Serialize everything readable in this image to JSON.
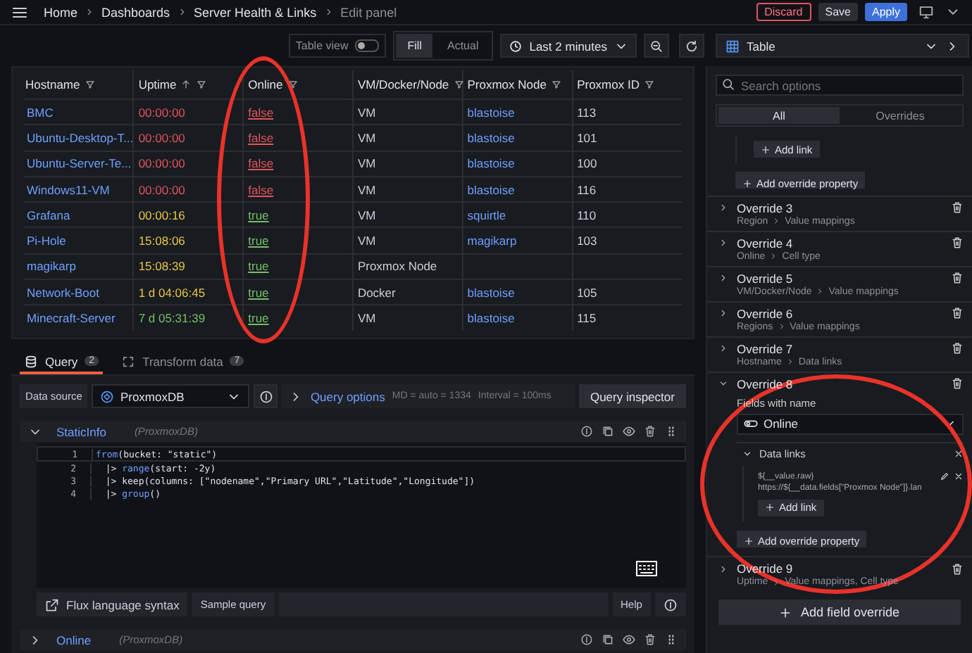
{
  "breadcrumbs": [
    "Home",
    "Dashboards",
    "Server Health & Links",
    "Edit panel"
  ],
  "header_buttons": [
    {
      "label": "Discard",
      "kind": "danger"
    },
    {
      "label": "Save",
      "kind": "secondary"
    },
    {
      "label": "Apply",
      "kind": "primary"
    }
  ],
  "toolbar": {
    "table_view": {
      "label": "Table view",
      "on": false
    },
    "fill_modes": [
      {
        "label": "Fill",
        "selected": true
      },
      {
        "label": "Actual",
        "selected": false
      }
    ],
    "time_range": "Last 2 minutes"
  },
  "visualization": {
    "label": "Table"
  },
  "table": {
    "columns": [
      {
        "label": "Hostname",
        "sorted": false
      },
      {
        "label": "Uptime",
        "sorted": true
      },
      {
        "label": "Online",
        "sorted": false
      },
      {
        "label": "VM/Docker/Node",
        "sorted": false
      },
      {
        "label": "Proxmox Node",
        "sorted": false
      },
      {
        "label": "Proxmox ID",
        "sorted": false
      }
    ],
    "rows": [
      {
        "hostname": "BMC",
        "uptime": {
          "text": "00:00:00",
          "color": "#e0535f"
        },
        "online": {
          "text": "false",
          "color": "#e0535f"
        },
        "type": "VM",
        "proxmox_node": "blastoise",
        "proxmox_id": "113"
      },
      {
        "hostname": "Ubuntu-Desktop-T...",
        "uptime": {
          "text": "00:00:00",
          "color": "#e0535f"
        },
        "online": {
          "text": "false",
          "color": "#e0535f"
        },
        "type": "VM",
        "proxmox_node": "blastoise",
        "proxmox_id": "101"
      },
      {
        "hostname": "Ubuntu-Server-Te...",
        "uptime": {
          "text": "00:00:00",
          "color": "#e0535f"
        },
        "online": {
          "text": "false",
          "color": "#e0535f"
        },
        "type": "VM",
        "proxmox_node": "blastoise",
        "proxmox_id": "100"
      },
      {
        "hostname": "Windows11-VM",
        "uptime": {
          "text": "00:00:00",
          "color": "#e0535f"
        },
        "online": {
          "text": "false",
          "color": "#e0535f"
        },
        "type": "VM",
        "proxmox_node": "blastoise",
        "proxmox_id": "116"
      },
      {
        "hostname": "Grafana",
        "uptime": {
          "text": "00:00:16",
          "color": "#e6c54a"
        },
        "online": {
          "text": "true",
          "color": "#73bf69"
        },
        "type": "VM",
        "proxmox_node": "squirtle",
        "proxmox_id": "110"
      },
      {
        "hostname": "Pi-Hole",
        "uptime": {
          "text": "15:08:06",
          "color": "#e6c54a"
        },
        "online": {
          "text": "true",
          "color": "#73bf69"
        },
        "type": "VM",
        "proxmox_node": "magikarp",
        "proxmox_id": "103"
      },
      {
        "hostname": "magikarp",
        "uptime": {
          "text": "15:08:39",
          "color": "#e6c54a"
        },
        "online": {
          "text": "true",
          "color": "#73bf69"
        },
        "type": "Proxmox Node"
      },
      {
        "hostname": "Network-Boot",
        "uptime": {
          "text": "1 d 04:06:45",
          "color": "#e6c54a"
        },
        "online": {
          "text": "true",
          "color": "#73bf69"
        },
        "type": "Docker",
        "proxmox_node": "blastoise",
        "proxmox_id": "105"
      },
      {
        "hostname": "Minecraft-Server",
        "uptime": {
          "text": "7 d 05:31:39",
          "color": "#73bf69"
        },
        "online": {
          "text": "true",
          "color": "#73bf69"
        },
        "type": "VM",
        "proxmox_node": "blastoise",
        "proxmox_id": "115"
      }
    ]
  },
  "query_tabs": [
    {
      "label": "Query",
      "count": "2",
      "selected": true
    },
    {
      "label": "Transform data",
      "count": "7",
      "selected": false
    }
  ],
  "query_bar": {
    "data_source_label": "Data source",
    "data_source": "ProxmoxDB",
    "query_options": "Query options",
    "max_data_points": "MD = auto = 1334",
    "interval": "Interval = 100ms",
    "inspector": "Query inspector"
  },
  "queries": [
    {
      "name": "StaticInfo",
      "source": "(ProxmoxDB)",
      "expanded": true,
      "code": [
        {
          "number": "1",
          "tokens": [
            {
              "text": "from",
              "kind": "fn"
            },
            {
              "text": "(bucket: \"static\")",
              "kind": "plain"
            }
          ]
        },
        {
          "number": "2",
          "tokens": [
            {
              "text": "  |> ",
              "kind": "plain"
            },
            {
              "text": "range",
              "kind": "fn"
            },
            {
              "text": "(start: -2y)",
              "kind": "plain"
            }
          ]
        },
        {
          "number": "3",
          "tokens": [
            {
              "text": "  |> ",
              "kind": "plain"
            },
            {
              "text": "keep",
              "kind": "plain"
            },
            {
              "text": "(columns: [\"nodename\",\"Primary URL\",\"Latitude\",\"Longitude\"])",
              "kind": "plain"
            }
          ]
        },
        {
          "number": "4",
          "tokens": [
            {
              "text": "  |> ",
              "kind": "plain"
            },
            {
              "text": "group",
              "kind": "fn"
            },
            {
              "text": "()",
              "kind": "plain"
            }
          ]
        }
      ],
      "footer": {
        "syntax": "Flux language syntax",
        "sample": "Sample query",
        "help": "Help"
      }
    },
    {
      "name": "Online",
      "source": "(ProxmoxDB)",
      "expanded": false
    }
  ],
  "options": {
    "search_placeholder": "Search options",
    "tabs": [
      {
        "label": "All",
        "selected": true
      },
      {
        "label": "Overrides",
        "selected": false
      }
    ],
    "top_fragment": {
      "add_link": "Add link",
      "add_property": "Add override property"
    },
    "overrides": [
      {
        "title": "Override 3",
        "path": [
          "Region",
          "Value mappings"
        ],
        "expanded": false
      },
      {
        "title": "Override 4",
        "path": [
          "Online",
          "Cell type"
        ],
        "expanded": false
      },
      {
        "title": "Override 5",
        "path": [
          "VM/Docker/Node",
          "Value mappings"
        ],
        "expanded": false
      },
      {
        "title": "Override 6",
        "path": [
          "Regions",
          "Value mappings"
        ],
        "expanded": false
      },
      {
        "title": "Override 7",
        "path": [
          "Hostname",
          "Data links"
        ],
        "expanded": false
      },
      {
        "title": "Override 8",
        "expanded": true,
        "matcher": "Fields with name",
        "field": "Online",
        "property": "Data links",
        "link": {
          "title": "${__value.raw}",
          "url": "https://${__data.fields[\"Proxmox Node\"]}.lan"
        },
        "add_link": "Add link",
        "add_property": "Add override property"
      },
      {
        "title": "Override 9",
        "path": [
          "Uptime",
          "Value mappings, Cell type"
        ],
        "expanded": false
      }
    ],
    "add_field_override": "Add field override"
  }
}
